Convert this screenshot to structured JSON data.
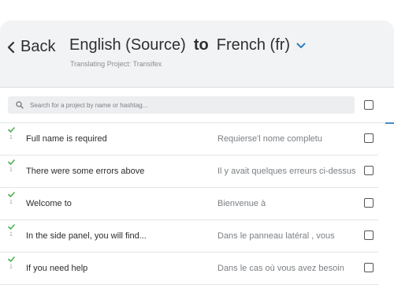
{
  "header": {
    "back_label": "Back",
    "source_language": "English (Source)",
    "to_word": "to",
    "target_language": "French (fr)",
    "subtitle": "Translating Project: Transifex"
  },
  "search": {
    "placeholder": "Search for a project by name or hashtag..."
  },
  "rows": [
    {
      "source": "Full name is required",
      "translation": "Requierse'l nome completu",
      "count": "1",
      "checked": false
    },
    {
      "source": "There were some errors above",
      "translation": "Il y avait quelques erreurs ci-dessus",
      "count": "1",
      "checked": false
    },
    {
      "source": "Welcome to",
      "translation": "Bienvenue à",
      "count": "1",
      "checked": false
    },
    {
      "source": "In the side panel, you will find...",
      "translation": "Dans le panneau latéral , vous",
      "count": "1",
      "checked": false
    },
    {
      "source": "If you need help",
      "translation": "Dans le cas où vous avez besoin",
      "count": "1",
      "checked": false
    }
  ],
  "colors": {
    "accent": "#2f7fb8",
    "status_check": "#4caf50",
    "header_bg": "#f2f3f5"
  },
  "icons": [
    "chevron-left-icon",
    "chevron-down-icon",
    "search-icon",
    "checkmark-icon"
  ]
}
